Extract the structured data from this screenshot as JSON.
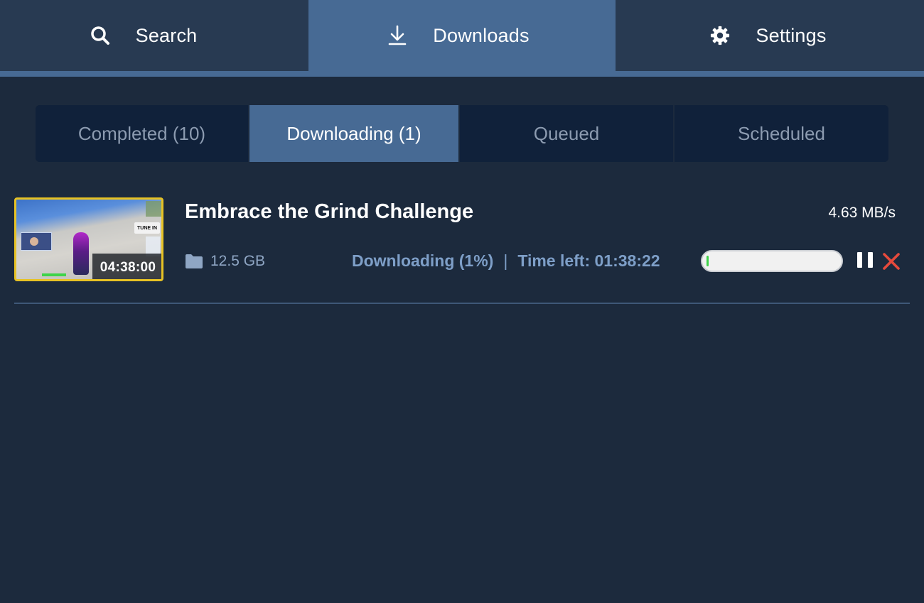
{
  "nav": {
    "tabs": [
      {
        "label": "Search",
        "icon": "search-icon"
      },
      {
        "label": "Downloads",
        "icon": "download-icon"
      },
      {
        "label": "Settings",
        "icon": "gear-icon"
      }
    ],
    "active": "Downloads"
  },
  "subtabs": [
    {
      "label": "Completed (10)"
    },
    {
      "label": "Downloading (1)"
    },
    {
      "label": "Queued"
    },
    {
      "label": "Scheduled"
    }
  ],
  "download": {
    "title": "Embrace the Grind Challenge",
    "speed": "4.63 MB/s",
    "duration": "04:38:00",
    "size": "12.5 GB",
    "status": "Downloading (1%)",
    "separator": "|",
    "time_left": "Time left: 01:38:22",
    "progress_fraction": 0.01,
    "thumbnail_badge": "TUNE IN"
  },
  "colors": {
    "background": "#1c2a3d",
    "nav_bg": "#283a52",
    "accent": "#476a94",
    "status_text": "#7e9fc8",
    "thumbnail_border": "#e7c224",
    "progress_fill": "#3fd34a",
    "cancel": "#e64a3c"
  }
}
